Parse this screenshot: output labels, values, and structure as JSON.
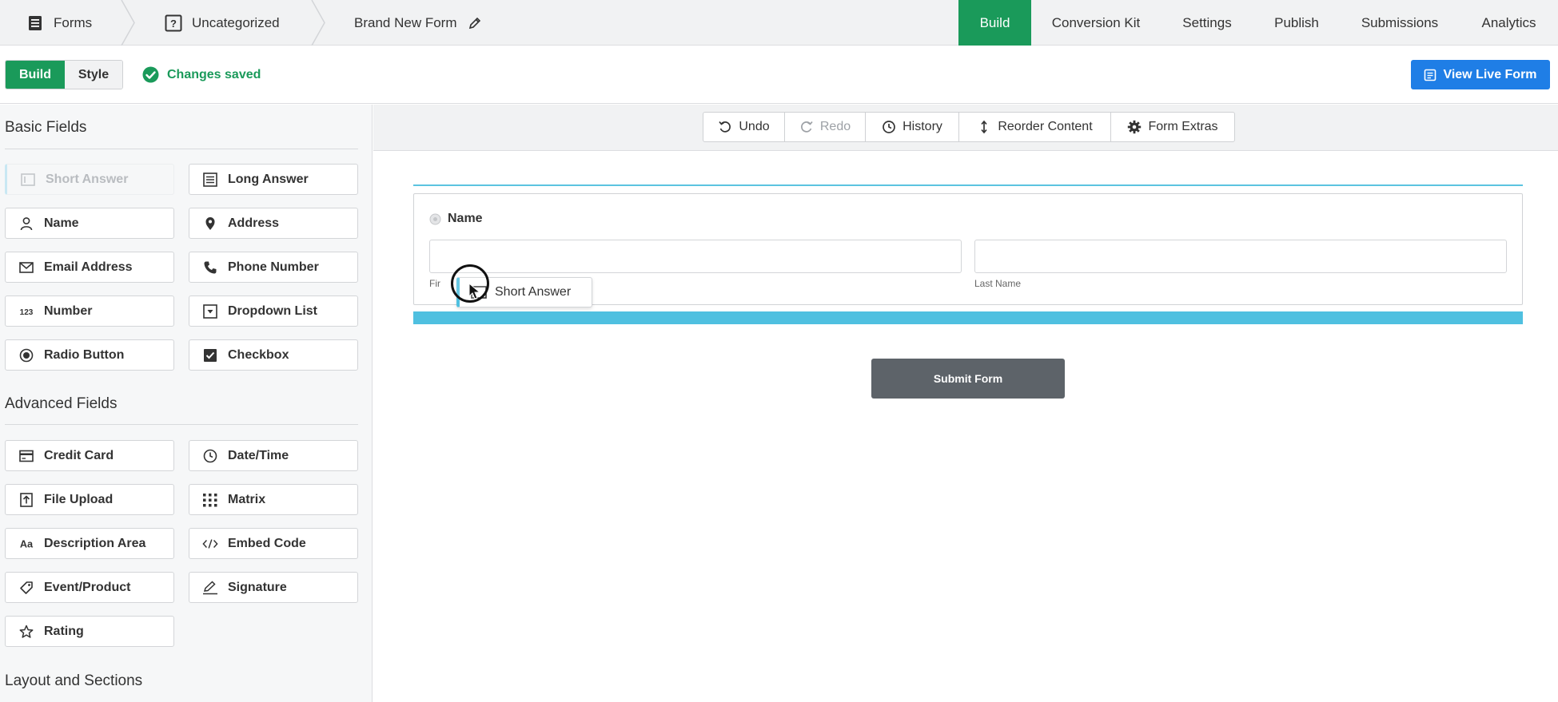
{
  "breadcrumbs": [
    {
      "label": "Forms",
      "icon": "forms-list-icon"
    },
    {
      "label": "Uncategorized",
      "icon": "uncategorized-icon"
    },
    {
      "label": "Brand New Form",
      "icon": "pencil-icon"
    }
  ],
  "nav_tabs": [
    "Build",
    "Conversion Kit",
    "Settings",
    "Publish",
    "Submissions",
    "Analytics"
  ],
  "mode_toggle": {
    "build": "Build",
    "style": "Style"
  },
  "status": "Changes saved",
  "view_live_label": "View Live Form",
  "toolbar": {
    "undo": "Undo",
    "redo": "Redo",
    "history": "History",
    "reorder": "Reorder Content",
    "extras": "Form Extras"
  },
  "sections": {
    "basic": "Basic Fields",
    "advanced": "Advanced Fields",
    "layout": "Layout and Sections"
  },
  "basic_fields": [
    {
      "label": "Short Answer",
      "icon": "short-answer-icon"
    },
    {
      "label": "Long Answer",
      "icon": "long-answer-icon"
    },
    {
      "label": "Name",
      "icon": "person-icon"
    },
    {
      "label": "Address",
      "icon": "map-pin-icon"
    },
    {
      "label": "Email Address",
      "icon": "envelope-icon"
    },
    {
      "label": "Phone Number",
      "icon": "phone-icon"
    },
    {
      "label": "Number",
      "icon": "number-123-icon"
    },
    {
      "label": "Dropdown List",
      "icon": "dropdown-icon"
    },
    {
      "label": "Radio Button",
      "icon": "radio-icon"
    },
    {
      "label": "Checkbox",
      "icon": "checkbox-icon"
    }
  ],
  "advanced_fields": [
    {
      "label": "Credit Card",
      "icon": "credit-card-icon"
    },
    {
      "label": "Date/Time",
      "icon": "clock-icon"
    },
    {
      "label": "File Upload",
      "icon": "file-upload-icon"
    },
    {
      "label": "Matrix",
      "icon": "matrix-icon"
    },
    {
      "label": "Description Area",
      "icon": "text-aa-icon"
    },
    {
      "label": "Embed Code",
      "icon": "code-icon"
    },
    {
      "label": "Event/Product",
      "icon": "tag-icon"
    },
    {
      "label": "Signature",
      "icon": "signature-pen-icon"
    },
    {
      "label": "Rating",
      "icon": "star-icon"
    }
  ],
  "canvas": {
    "field_label": "Name",
    "first_sublabel": "Fir",
    "last_sublabel": "Last Name",
    "dragging_label": "Short Answer",
    "submit_label": "Submit Form"
  },
  "colors": {
    "accent_green": "#1a9a5a",
    "primary_blue": "#1f7ee6",
    "drop_indicator": "#4fc0e0",
    "submit_gray": "#5d6369"
  }
}
